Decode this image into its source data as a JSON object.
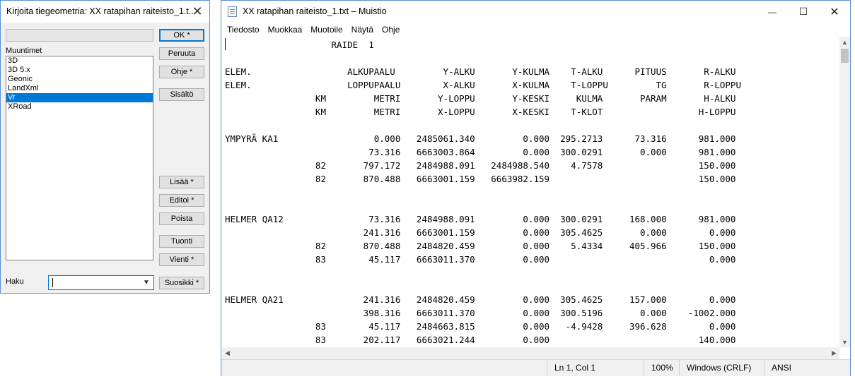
{
  "dialog": {
    "title": "Kirjoita tiegeometria: XX ratapihan raiteisto_1.t...",
    "close_glyph": "✕",
    "list_label": "Muuntimet",
    "items": [
      "3D",
      "3D 5.x",
      "Geonic",
      "LandXml",
      "Vr",
      "XRoad"
    ],
    "selected_item": "Vr",
    "buttons": {
      "ok": "OK *",
      "cancel": "Peruuta",
      "help": "Ohje *",
      "contents": "Sisältö",
      "add": "Lisää *",
      "edit": "Editoi *",
      "delete": "Poista",
      "import": "Tuonti",
      "export": "Vienti *",
      "favorites": "Suosikki *"
    },
    "search_label": "Haku",
    "search_value": ""
  },
  "notepad": {
    "title": "XX ratapihan raiteisto_1.txt – Muistio",
    "minimize_glyph": "—",
    "maximize_glyph": "☐",
    "close_glyph": "✕",
    "menu": [
      "Tiedosto",
      "Muokkaa",
      "Muotoile",
      "Näytä",
      "Ohje"
    ],
    "lines": [
      "                    RAIDE  1",
      "",
      "ELEM.                  ALKUPAALU         Y-ALKU       Y-KULMA    T-ALKU      PITUUS       R-ALKU",
      "ELEM.                  LOPPUPAALU        X-ALKU       X-KULMA    T-LOPPU         TG       R-LOPPU",
      "                 KM         METRI       Y-LOPPU       Y-KESKI     KULMA       PARAM       H-ALKU",
      "                 KM         METRI       X-LOPPU       X-KESKI    T-KLOT                  H-LOPPU",
      "",
      "YMPYRÄ KA1                  0.000   2485061.340         0.000  295.2713      73.316      981.000",
      "                           73.316   6663003.864         0.000  300.0291       0.000      981.000",
      "                 82       797.172   2484988.091   2484988.540    4.7578                  150.000",
      "                 82       870.488   6663001.159   6663982.159                            150.000",
      "",
      "",
      "HELMER QA12                73.316   2484988.091         0.000  300.0291     168.000      981.000",
      "                          241.316   6663001.159         0.000  305.4625       0.000        0.000",
      "                 82       870.488   2484820.459         0.000    5.4334     405.966      150.000",
      "                 83        45.117   6663011.370         0.000                              0.000",
      "",
      "",
      "HELMER QA21               241.316   2484820.459         0.000  305.4625     157.000        0.000",
      "                          398.316   6663011.370         0.000  300.5196       0.000    -1002.000",
      "                 83        45.117   2484663.815         0.000   -4.9428     396.628        0.000",
      "                 83       202.117   6663021.244         0.000                            140.000"
    ],
    "status": {
      "position": "Ln 1, Col 1",
      "zoom": "100%",
      "line_ending": "Windows (CRLF)",
      "encoding": "ANSI"
    }
  }
}
